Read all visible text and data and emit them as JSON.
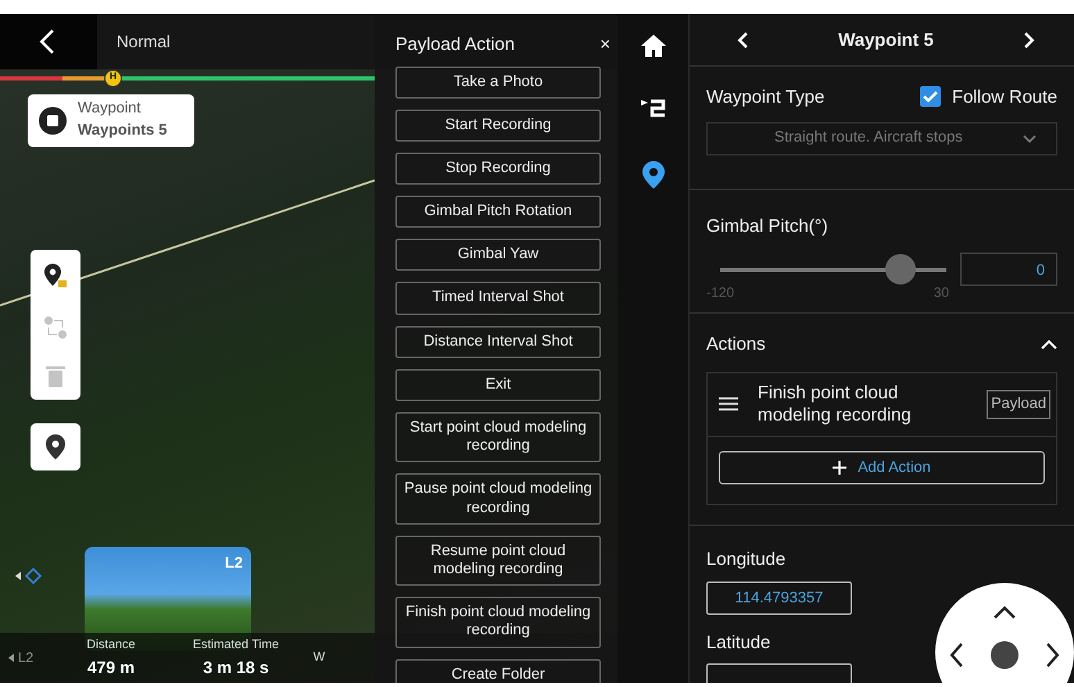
{
  "top_bar": {
    "mode": "Normal"
  },
  "route_progress": {
    "marker": "H",
    "level": 0.3
  },
  "waypoint_card": {
    "title": "Waypoint",
    "subtitle": "Waypoints 5"
  },
  "map_tools": [
    {
      "kind": "pin-lock",
      "disabled": false
    },
    {
      "kind": "route",
      "disabled": true
    },
    {
      "kind": "trash",
      "disabled": true
    }
  ],
  "camera_preview": {
    "label": "L2"
  },
  "lens_switch": {
    "label": "L2",
    "disabled": true
  },
  "stats": [
    {
      "label": "Distance",
      "value": "479 m"
    },
    {
      "label": "Estimated Time",
      "value": "3 m 18 s"
    },
    {
      "label": "W"
    }
  ],
  "payload_panel": {
    "title": "Payload Action",
    "close": "×",
    "actions": [
      "Take a Photo",
      "Start Recording",
      "Stop Recording",
      "Gimbal Pitch Rotation",
      "Gimbal Yaw",
      "Timed Interval Shot",
      "Distance Interval Shot",
      "Exit",
      "Start point cloud modeling recording",
      "Pause point cloud modeling recording",
      "Resume point cloud modeling recording",
      "Finish point cloud modeling recording",
      "Create Folder"
    ]
  },
  "nav": [
    {
      "kind": "home",
      "selected": false
    },
    {
      "kind": "route",
      "selected": false
    },
    {
      "kind": "pin",
      "selected": true
    }
  ],
  "waypoint_panel": {
    "title": "Waypoint 5",
    "waypoint_type": {
      "label": "Waypoint Type",
      "follow_route": {
        "label": "Follow Route",
        "checked": true
      },
      "select": {
        "value": "Straight route. Aircraft stops",
        "disabled": true
      }
    },
    "gimbal_pitch": {
      "label": "Gimbal Pitch(°)",
      "level": 0.8,
      "min": "-120",
      "max": "30",
      "value": "0"
    },
    "actions": {
      "label": "Actions",
      "expanded": true,
      "items": [
        {
          "name": "Finish point cloud modeling recording",
          "tag": "Payload"
        }
      ],
      "add_button": "Add Action"
    },
    "longitude": {
      "label": "Longitude",
      "value": "114.4793357"
    },
    "latitude": {
      "label": "Latitude"
    }
  }
}
